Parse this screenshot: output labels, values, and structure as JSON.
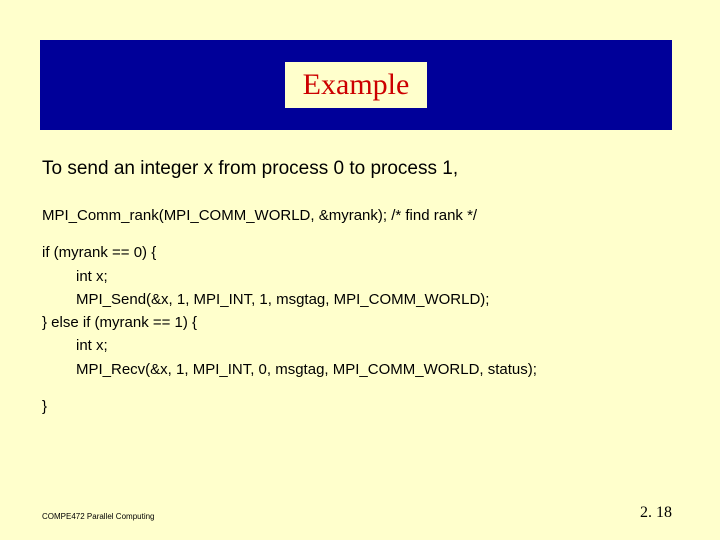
{
  "title": "Example",
  "intro": "To send an integer x from process 0 to process 1,",
  "code": {
    "l1": "MPI_Comm_rank(MPI_COMM_WORLD, &myrank); /* find rank */",
    "l2": "if (myrank == 0) {",
    "l3": "int x;",
    "l4": "MPI_Send(&x, 1, MPI_INT, 1, msgtag, MPI_COMM_WORLD);",
    "l5": "} else if (myrank == 1) {",
    "l6": "int x;",
    "l7": "MPI_Recv(&x, 1, MPI_INT, 0, msgtag, MPI_COMM_WORLD, status);",
    "l8": "}"
  },
  "footer": {
    "left": "COMPE472 Parallel Computing",
    "right": "2. 18"
  }
}
